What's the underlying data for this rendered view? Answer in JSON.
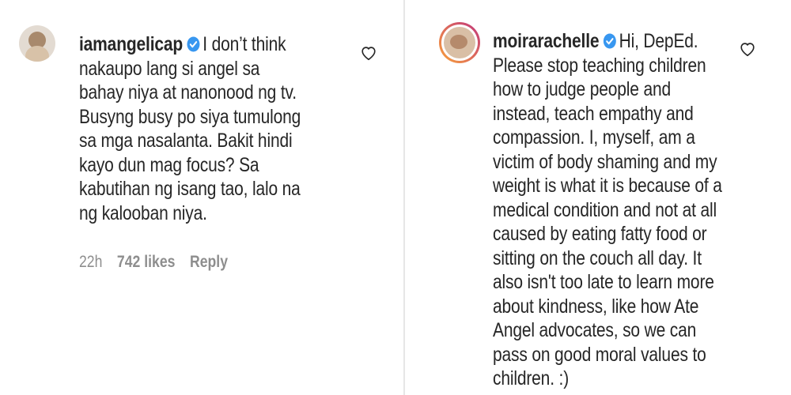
{
  "comments": [
    {
      "username": "iamangelicap",
      "verified": true,
      "text": "I don’t think nakaupo lang si angel sa bahay niya at nanonood ng tv. Busyng busy po siya tumulong sa mga nasalanta. Bakit hindi kayo dun mag focus? Sa kabutihan ng isang tao, lalo na ng kalooban niya.",
      "time": "22h",
      "likes": "742 likes",
      "reply": "Reply",
      "like_icon": "heart-outline-icon"
    },
    {
      "username": "moirarachelle",
      "verified": true,
      "text": "Hi, DepEd. Please stop teaching children how to judge people and instead, teach empathy and compassion. I, myself, am a victim of body shaming and my weight is what it is because of a medical condition and not at all caused by eating fatty food or sitting on the couch all day. It also isn't too late to learn more about kindness, like how Ate Angel advocates, so we can pass on good moral values to children. :)",
      "like_icon": "heart-outline-icon"
    }
  ],
  "colors": {
    "text": "#262626",
    "meta": "#8e8e8e",
    "verified": "#3897f0",
    "story_ring_start": "#f9a23a",
    "story_ring_end": "#c1357c"
  }
}
